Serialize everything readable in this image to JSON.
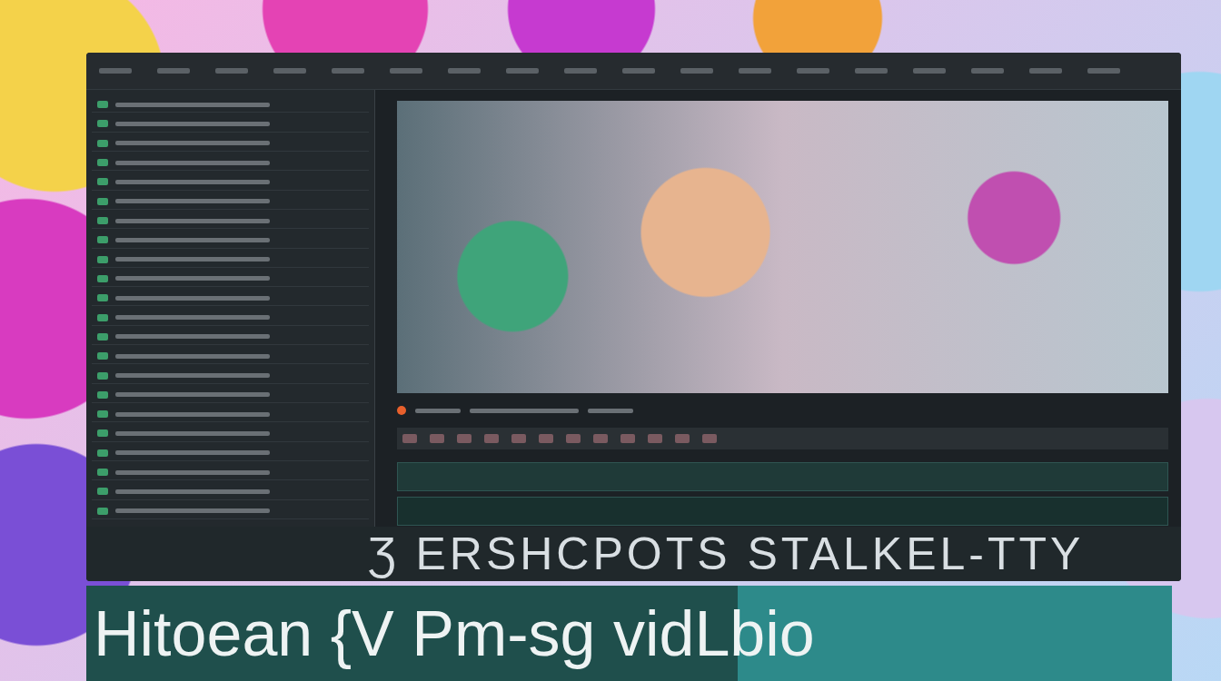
{
  "overlay_caption": "Ʒ ERSHCPOTS STALKEL-TTY",
  "banner_title": "Hitoean {V Pm-sg vidLbio"
}
